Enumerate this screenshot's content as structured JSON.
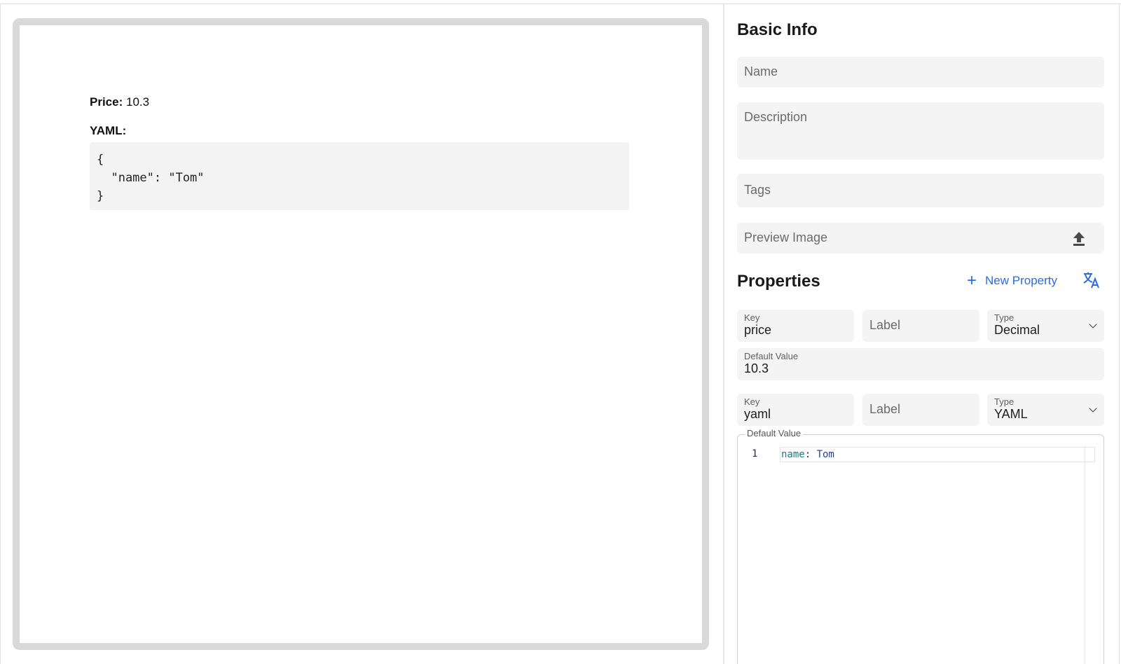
{
  "preview": {
    "price_label": "Price:",
    "price_value": "10.3",
    "yaml_label": "YAML:",
    "yaml_code": "{\n  \"name\": \"Tom\"\n}"
  },
  "basic_info": {
    "title": "Basic Info",
    "name_placeholder": "Name",
    "description_placeholder": "Description",
    "tags_placeholder": "Tags",
    "preview_image_placeholder": "Preview Image",
    "upload_icon": "upload-icon"
  },
  "properties": {
    "title": "Properties",
    "new_property_label": "New Property",
    "translate_icon": "translate-icon",
    "accent_color": "#2d6be0",
    "items": [
      {
        "key_label": "Key",
        "key_value": "price",
        "label_placeholder": "Label",
        "type_label": "Type",
        "type_value": "Decimal",
        "default_label": "Default Value",
        "default_value": "10.3"
      },
      {
        "key_label": "Key",
        "key_value": "yaml",
        "label_placeholder": "Label",
        "type_label": "Type",
        "type_value": "YAML",
        "default_label": "Default Value",
        "editor": {
          "line_number": "1",
          "code_key": "name",
          "code_sep": ": ",
          "code_value": "Tom"
        }
      }
    ]
  }
}
